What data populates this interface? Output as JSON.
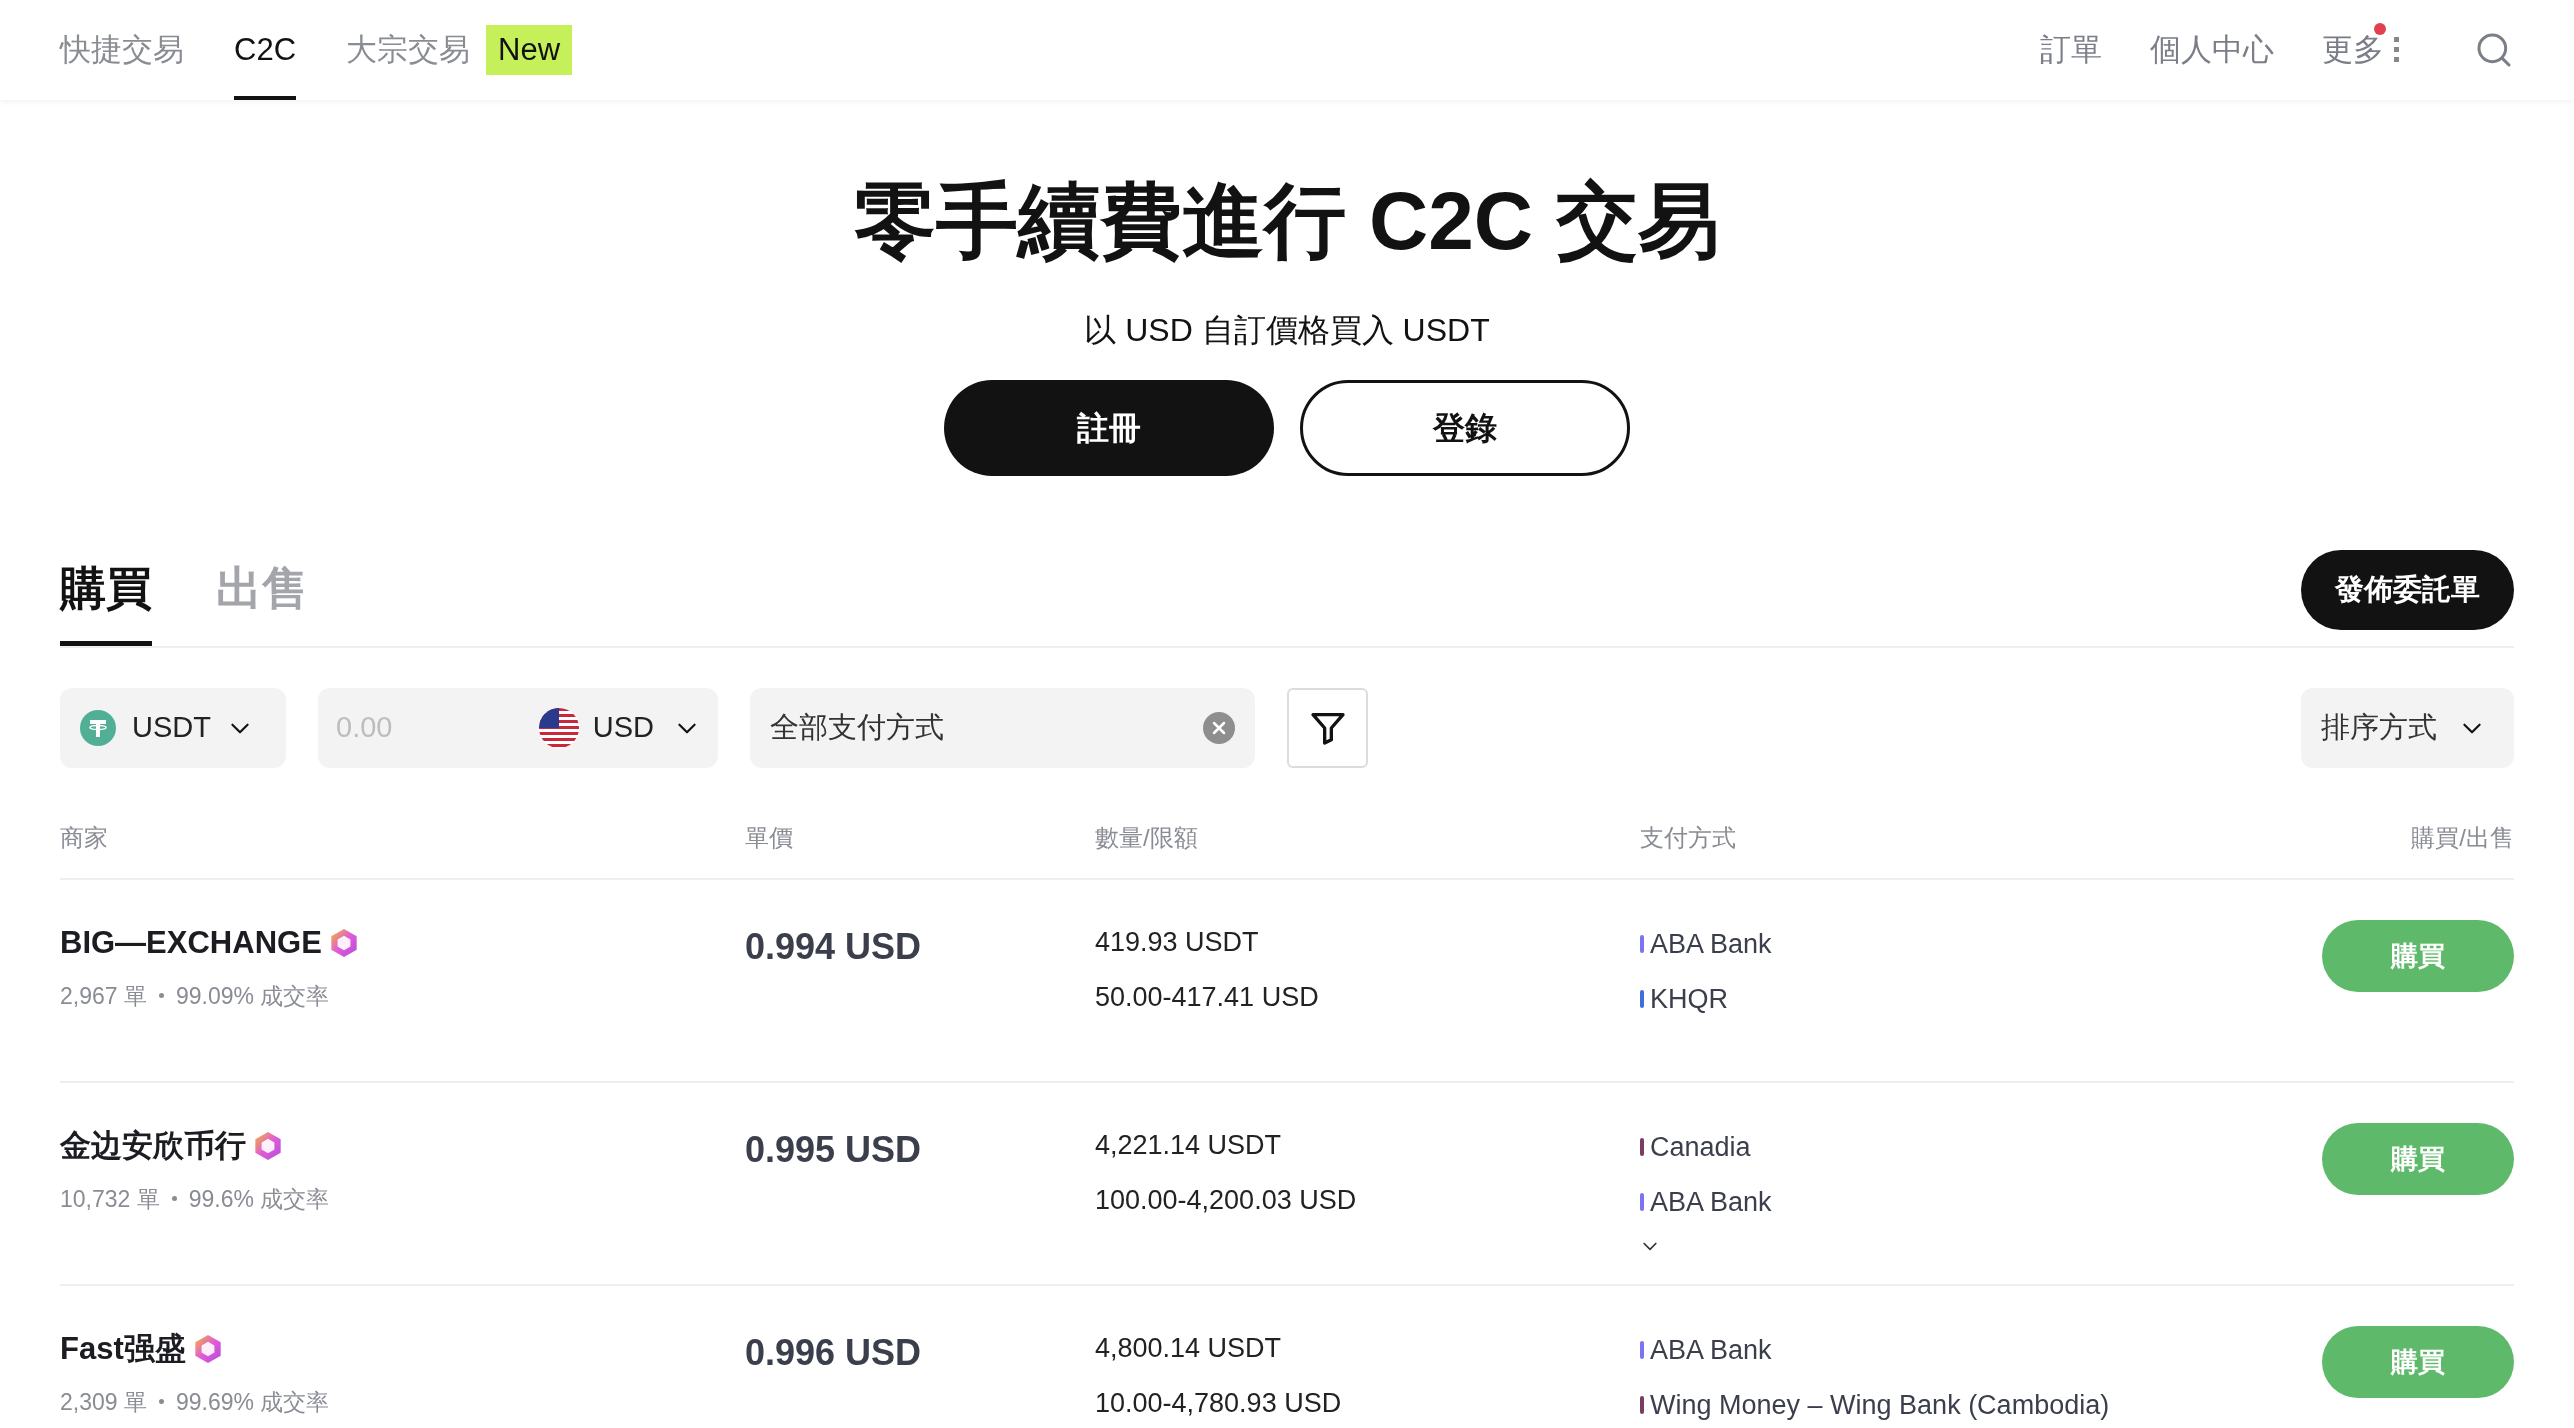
{
  "nav": {
    "items": [
      {
        "label": "快捷交易",
        "selected": false
      },
      {
        "label": "C2C",
        "selected": true
      },
      {
        "label": "大宗交易",
        "selected": false,
        "badge": "New"
      }
    ],
    "right_items": [
      {
        "label": "訂單",
        "notification": false,
        "menu": false
      },
      {
        "label": "個人中心",
        "notification": false,
        "menu": false
      },
      {
        "label": "更多",
        "notification": true,
        "menu": true
      }
    ]
  },
  "hero": {
    "title": "零手續費進行 C2C 交易",
    "subtitle": "以 USD 自訂價格買入 USDT",
    "buttons": [
      {
        "label": "註冊",
        "kind": "primary"
      },
      {
        "label": "登錄",
        "kind": "outline"
      }
    ]
  },
  "trade_tabs": [
    {
      "label": "購買",
      "selected": true
    },
    {
      "label": "出售",
      "selected": false
    }
  ],
  "post_button": "發佈委託單",
  "filters": {
    "crypto": "USDT",
    "amount_placeholder": "0.00",
    "fiat": "USD",
    "payment": "全部支付方式",
    "sort": "排序方式"
  },
  "table": {
    "columns": [
      "商家",
      "單價",
      "數量/限額",
      "支付方式",
      "購買/出售"
    ],
    "rows": [
      {
        "merchant": "BIG—EXCHANGE",
        "orders": "2,967 單",
        "rate": "99.09% 成交率",
        "price": "0.994 USD",
        "quantity": "419.93 USDT",
        "limit": "50.00-417.41 USD",
        "expandable": false,
        "payments": [
          {
            "name": "ABA Bank",
            "color": "#7b73f0"
          },
          {
            "name": "KHQR",
            "color": "#3f6fd8"
          }
        ],
        "action": "購買"
      },
      {
        "merchant": "金边安欣币行",
        "orders": "10,732 單",
        "rate": "99.6% 成交率",
        "price": "0.995 USD",
        "quantity": "4,221.14 USDT",
        "limit": "100.00-4,200.03 USD",
        "expandable": true,
        "payments": [
          {
            "name": "Canadia",
            "color": "#7a3d62"
          },
          {
            "name": "ABA Bank",
            "color": "#7b73f0"
          }
        ],
        "action": "購買"
      },
      {
        "merchant": "Fast强盛",
        "orders": "2,309 單",
        "rate": "99.69% 成交率",
        "price": "0.996 USD",
        "quantity": "4,800.14 USDT",
        "limit": "10.00-4,780.93 USD",
        "payments": [
          {
            "name": "ABA Bank",
            "color": "#7b73f0"
          },
          {
            "name": "Wing Money – Wing Bank (Cambodia)",
            "color": "#7a3d62"
          }
        ],
        "action": "購買"
      }
    ]
  }
}
